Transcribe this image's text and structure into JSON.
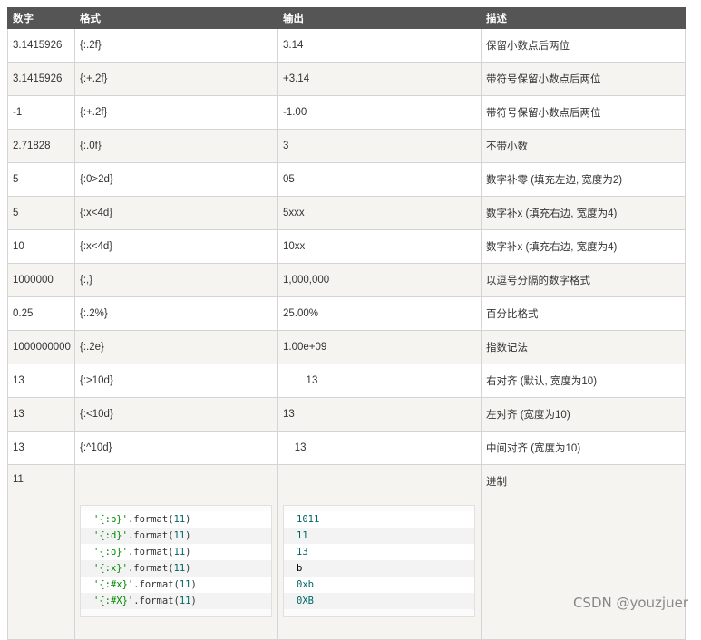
{
  "table": {
    "headers": [
      "数字",
      "格式",
      "输出",
      "描述"
    ],
    "rows": [
      [
        "3.1415926",
        "{:.2f}",
        "3.14",
        "保留小数点后两位"
      ],
      [
        "3.1415926",
        "{:+.2f}",
        "+3.14",
        "带符号保留小数点后两位"
      ],
      [
        "-1",
        "{:+.2f}",
        "-1.00",
        "带符号保留小数点后两位"
      ],
      [
        "2.71828",
        "{:.0f}",
        "3",
        "不带小数"
      ],
      [
        "5",
        "{:0>2d}",
        "05",
        "数字补零 (填充左边, 宽度为2)"
      ],
      [
        "5",
        "{:x<4d}",
        "5xxx",
        "数字补x (填充右边, 宽度为4)"
      ],
      [
        "10",
        "{:x<4d}",
        "10xx",
        "数字补x (填充右边, 宽度为4)"
      ],
      [
        "1000000",
        "{:,}",
        "1,000,000",
        "以逗号分隔的数字格式"
      ],
      [
        "0.25",
        "{:.2%}",
        "25.00%",
        "百分比格式"
      ],
      [
        "1000000000",
        "{:.2e}",
        "1.00e+09",
        "指数记法"
      ],
      [
        "13",
        "{:>10d}",
        "        13",
        "右对齐 (默认, 宽度为10)"
      ],
      [
        "13",
        "{:<10d}",
        "13",
        "左对齐 (宽度为10)"
      ],
      [
        "13",
        "{:^10d}",
        "    13",
        "中间对齐 (宽度为10)"
      ]
    ],
    "last_row": {
      "number": "11",
      "description": "进制",
      "code": [
        {
          "str": "'{:b}'",
          "method": ".format(",
          "arg": "11",
          "close": ")"
        },
        {
          "str": "'{:d}'",
          "method": ".format(",
          "arg": "11",
          "close": ")"
        },
        {
          "str": "'{:o}'",
          "method": ".format(",
          "arg": "11",
          "close": ")"
        },
        {
          "str": "'{:x}'",
          "method": ".format(",
          "arg": "11",
          "close": ")"
        },
        {
          "str": "'{:#x}'",
          "method": ".format(",
          "arg": "11",
          "close": ")"
        },
        {
          "str": "'{:#X}'",
          "method": ".format(",
          "arg": "11",
          "close": ")"
        }
      ],
      "output": [
        "1011",
        "11",
        "13",
        "b",
        "0xb",
        "0XB"
      ]
    }
  },
  "watermark": "CSDN @youzjuer",
  "colors": {
    "header_bg": "#555555",
    "alt_row_bg": "#f6f4f0",
    "code_string": "#008800",
    "code_number": "#006666"
  }
}
